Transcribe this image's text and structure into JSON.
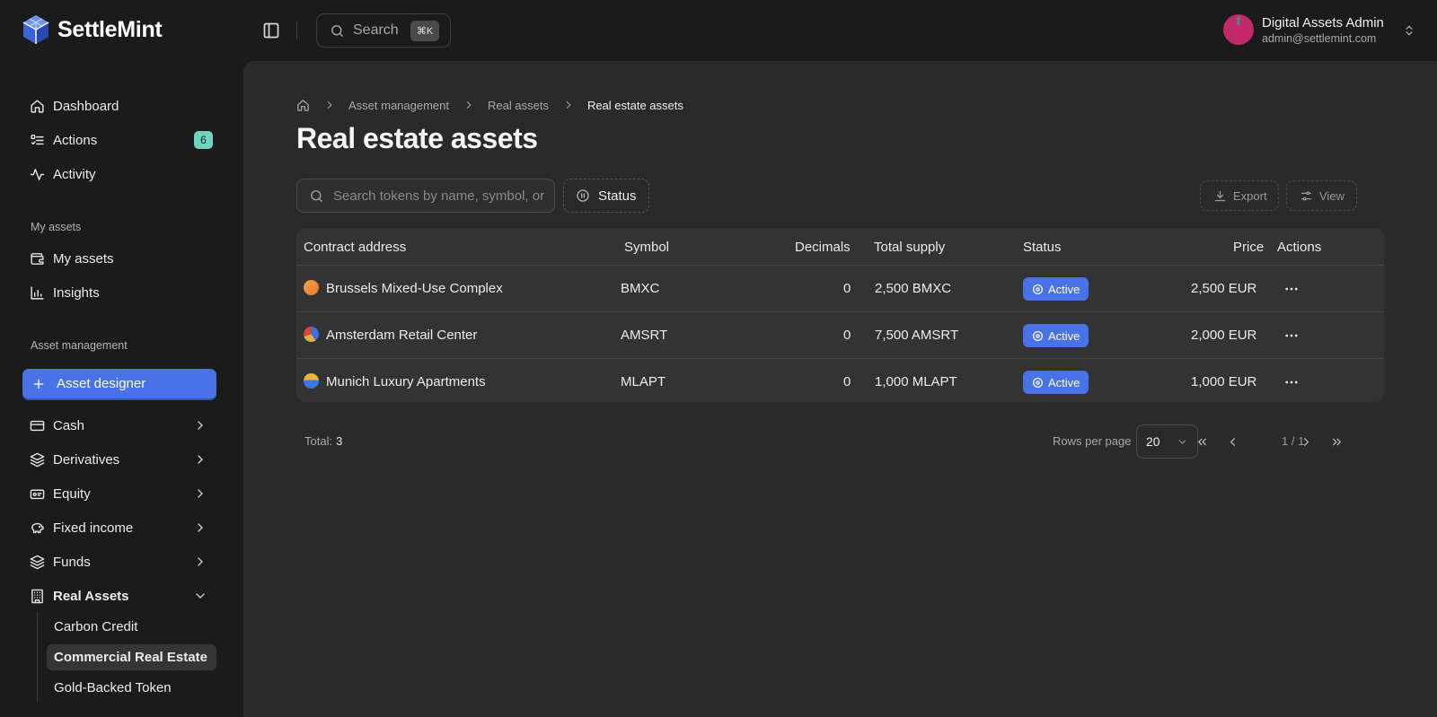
{
  "app": {
    "name": "SettleMint"
  },
  "topbar": {
    "search_label": "Search",
    "search_shortcut": "⌘K"
  },
  "user": {
    "name": "Digital Assets Admin",
    "email": "admin@settlemint.com"
  },
  "sidebar": {
    "main_items": [
      {
        "label": "Dashboard",
        "icon": "home-icon"
      },
      {
        "label": "Actions",
        "icon": "list-todo-icon",
        "badge": "6"
      },
      {
        "label": "Activity",
        "icon": "activity-icon"
      }
    ],
    "my_assets_section": "My assets",
    "my_assets_items": [
      {
        "label": "My assets",
        "icon": "wallet-icon"
      },
      {
        "label": "Insights",
        "icon": "bar-chart-icon"
      }
    ],
    "asset_management_section": "Asset management",
    "asset_designer_label": "Asset designer",
    "categories": [
      {
        "label": "Cash",
        "icon": "banknote-icon"
      },
      {
        "label": "Derivatives",
        "icon": "layers-icon"
      },
      {
        "label": "Equity",
        "icon": "ticket-icon"
      },
      {
        "label": "Fixed income",
        "icon": "piggy-bank-icon"
      },
      {
        "label": "Funds",
        "icon": "layers-icon"
      },
      {
        "label": "Real Assets",
        "icon": "building-icon"
      }
    ],
    "real_assets_children": [
      {
        "label": "Carbon Credit",
        "active": false
      },
      {
        "label": "Commercial Real Estate",
        "active": true
      },
      {
        "label": "Gold-Backed Token",
        "active": false
      }
    ]
  },
  "breadcrumb": [
    "Asset management",
    "Real assets",
    "Real estate assets"
  ],
  "page": {
    "title": "Real estate assets",
    "search_placeholder": "Search tokens by name, symbol, or address",
    "status_filter_label": "Status",
    "export_label": "Export",
    "view_label": "View"
  },
  "table": {
    "columns": [
      "Contract address",
      "Symbol",
      "Decimals",
      "Total supply",
      "Status",
      "Price",
      "Actions"
    ],
    "rows": [
      {
        "name": "Brussels Mixed-Use Complex",
        "symbol": "BMXC",
        "decimals": "0",
        "total_supply": "2,500 BMXC",
        "status": "Active",
        "price": "2,500 EUR",
        "icon_colors": [
          "#e8782a",
          "#f2a24a"
        ]
      },
      {
        "name": "Amsterdam Retail Center",
        "symbol": "AMSRT",
        "decimals": "0",
        "total_supply": "7,500 AMSRT",
        "status": "Active",
        "price": "2,000 EUR",
        "icon_colors": [
          "#3c6fe0",
          "#e2b23a"
        ]
      },
      {
        "name": "Munich Luxury Apartments",
        "symbol": "MLAPT",
        "decimals": "0",
        "total_supply": "1,000 MLAPT",
        "status": "Active",
        "price": "1,000 EUR",
        "icon_colors": [
          "#3a7ae0",
          "#f0b43a"
        ]
      }
    ]
  },
  "footer": {
    "total_label": "Total:",
    "total_value": "3",
    "rows_per_page_label": "Rows per page",
    "rows_per_page_value": "20",
    "page_indicator": "1 / 1"
  },
  "colors": {
    "accent": "#4a72e8",
    "badge": "#6fd2bf",
    "avatar": "#c2286a"
  }
}
